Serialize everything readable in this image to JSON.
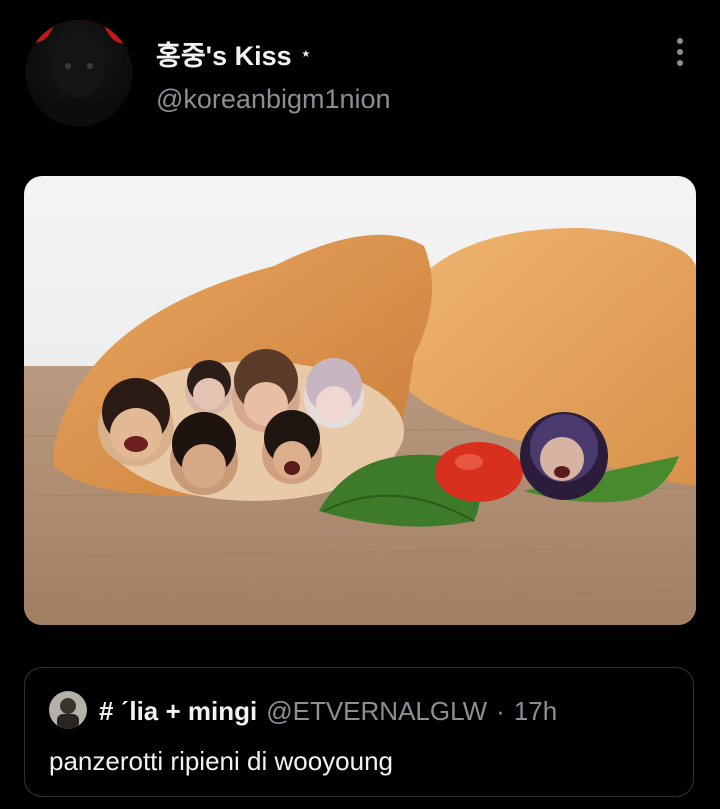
{
  "tweet": {
    "display_name": "홍중's Kiss",
    "name_badge": "⋆",
    "handle": "@koreanbigm1nion",
    "more_icon": "more-vertical-icon"
  },
  "media": {
    "description_icon": "photo-panzerotti"
  },
  "quote": {
    "name": "# ˊlia + mingi",
    "handle": "@ETVERNALGLW",
    "dot": "·",
    "time": "17h",
    "text": "panzerotti ripieni di wooyoung"
  },
  "colors": {
    "background": "#000000",
    "secondary_text": "#8b8f94",
    "border": "#2f3336"
  }
}
